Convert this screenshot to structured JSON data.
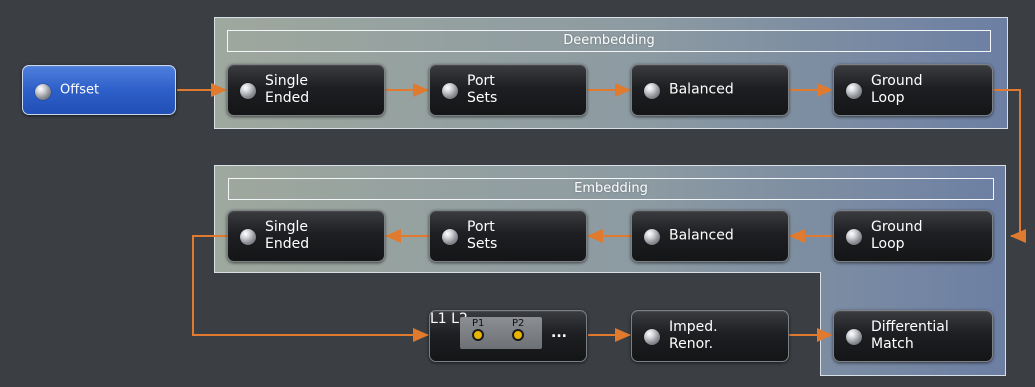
{
  "colors": {
    "background": "#3b3f43",
    "connector": "#e07a2e",
    "offset_accent": "#2e5fc9",
    "panel_border": "#d9dfe6"
  },
  "offset": {
    "label": "Offset"
  },
  "deembedding": {
    "title": "Deembedding",
    "steps": [
      {
        "label": "Single\nEnded"
      },
      {
        "label": "Port\nSets"
      },
      {
        "label": "Balanced"
      },
      {
        "label": "Ground\nLoop"
      }
    ]
  },
  "embedding": {
    "title": "Embedding",
    "steps": [
      {
        "label": "Single\nEnded"
      },
      {
        "label": "Port\nSets"
      },
      {
        "label": "Balanced"
      },
      {
        "label": "Ground\nLoop"
      }
    ]
  },
  "bottom_row": {
    "network_block": {
      "p1": "P1",
      "p2": "P2",
      "l1": "L1",
      "l2": "L2",
      "more": "..."
    },
    "imped_renor": {
      "label": "Imped.\nRenor."
    },
    "differential_match": {
      "label": "Differential\nMatch"
    }
  },
  "icons": [
    "led-indicator-icon",
    "arrow-right-icon",
    "arrow-left-icon",
    "port-network-icon"
  ]
}
